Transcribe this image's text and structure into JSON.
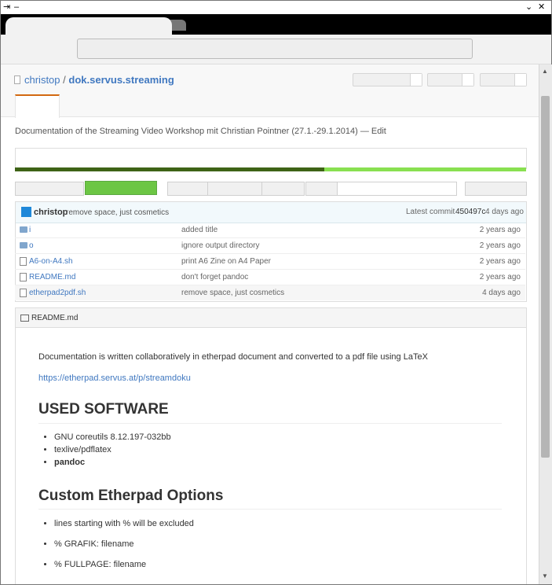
{
  "window": {
    "pin_label": "⇥",
    "minimize_label": "–",
    "down_label": "⌄",
    "close_label": "✕"
  },
  "repo": {
    "owner": "christop",
    "separator": "/",
    "name": "dok.servus.streaming",
    "description": "Documentation of the Streaming Video Workshop mit Christian Pointner (27.1.-29.1.2014) — Edit"
  },
  "latest_commit": {
    "author": "christop",
    "message": "remove space, just cosmetics",
    "label": "Latest commit",
    "sha": "450497c",
    "age": "4 days ago"
  },
  "files": [
    {
      "type": "folder",
      "name": "i",
      "message": "added title",
      "age": "2 years ago"
    },
    {
      "type": "folder",
      "name": "o",
      "message": "ignore output directory",
      "age": "2 years ago"
    },
    {
      "type": "file",
      "name": "A6-on-A4.sh",
      "message": "print A6 Zine on A4 Paper",
      "age": "2 years ago"
    },
    {
      "type": "file",
      "name": "README.md",
      "message": "don't forget pandoc",
      "age": "2 years ago"
    },
    {
      "type": "file",
      "name": "etherpad2pdf.sh",
      "message": "remove space, just cosmetics",
      "age": "4 days ago"
    }
  ],
  "readme": {
    "header": "README.md",
    "intro": "Documentation is written collaboratively in etherpad document and converted to a pdf file using LaTeX",
    "link": "https://etherpad.servus.at/p/streamdoku",
    "h_software": "USED SOFTWARE",
    "software": [
      "GNU coreutils 8.12.197-032bb",
      "texlive/pdflatex",
      "pandoc"
    ],
    "h_options": "Custom Etherpad Options",
    "options": [
      "lines starting with % will be excluded",
      "% GRAFIK: filename",
      "% FULLPAGE: filename"
    ]
  },
  "colors": {
    "link": "#4078c0",
    "lang_bar_dark": "#3e6316",
    "lang_bar_light": "#89e051",
    "green_button": "#6cc644",
    "tab_underline": "#d26911"
  }
}
